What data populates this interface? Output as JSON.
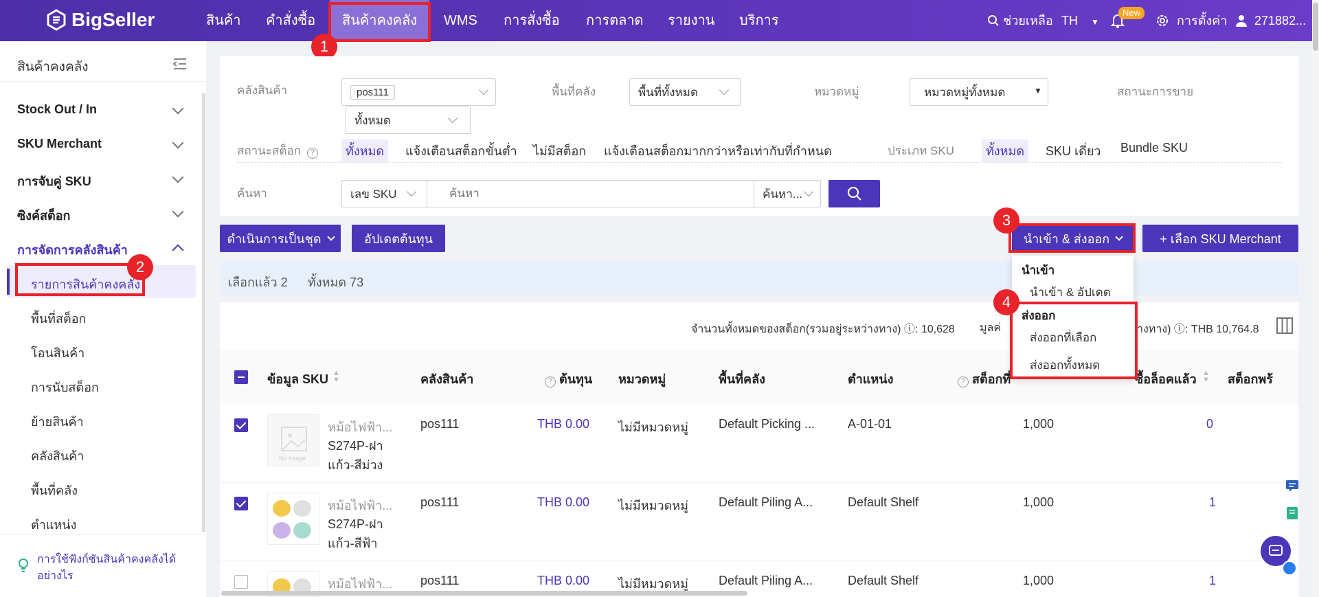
{
  "app": {
    "logo": "BigSeller"
  },
  "topnav": {
    "items": [
      "สินค้า",
      "คำสั่งซื้อ",
      "สินค้าคงคลัง",
      "WMS",
      "การสั่งซื้อ",
      "การตลาด",
      "รายงาน",
      "บริการ"
    ],
    "help": "ช่วยเหลือ",
    "lang": "TH",
    "new_badge": "New",
    "settings": "การตั้งค่า",
    "user": "271882..."
  },
  "steps": [
    "1",
    "2",
    "3",
    "4"
  ],
  "sidebar": {
    "title": "สินค้าคงคลัง",
    "groups": [
      "Stock Out / In",
      "SKU Merchant",
      "การจับคู่ SKU",
      "ซิงค์สต็อก",
      "การจัดการคลังสินค้า"
    ],
    "items": [
      "รายการสินค้าคงคลัง",
      "พื้นที่สต็อก",
      "โอนสินค้า",
      "การนับสต็อก",
      "ย้ายสินค้า",
      "คลังสินค้า",
      "พื้นที่คลัง",
      "ตำแหน่ง"
    ],
    "help_link": "การใช้ฟังก์ชันสินค้าคงคลังได้อย่างไร"
  },
  "filters": {
    "warehouse_label": "คลังสินค้า",
    "warehouse_tag": "pos111",
    "area_label": "พื้นที่คลัง",
    "area_value": "พื้นที่ทั้งหมด",
    "category_label": "หมวดหมู่",
    "category_value": "หมวดหมู่ทั้งหมด",
    "sale_status_label": "สถานะการขาย",
    "sale_status_value": "ทั้งหมด",
    "stock_status_label": "สถานะสต็อก",
    "stock_status_options": [
      "ทั้งหมด",
      "แจ้งเตือนสต็อกขั้นต่ำ",
      "ไม่มีสต็อก",
      "แจ้งเตือนสต็อกมากกว่าหรือเท่ากับที่กำหนด"
    ],
    "sku_type_label": "ประเภท SKU",
    "sku_type_options": [
      "ทั้งหมด",
      "SKU เดี่ยว",
      "Bundle SKU"
    ],
    "search_label": "ค้นหา",
    "search_field": "เลข SKU",
    "search_placeholder": "ค้นหา",
    "search_mode": "ค้นหา..."
  },
  "toolbar": {
    "batch": "ดำเนินการเป็นชุด",
    "update_cost": "อัปเดตต้นทุน",
    "import_export": "นำเข้า & ส่งออก",
    "add_sku": "+ เลือก SKU Merchant"
  },
  "selection": {
    "selected": "เลือกแล้ว 2",
    "total": "ทั้งหมด 73"
  },
  "summary": {
    "stock_total": "จำนวนทั้งหมดของสต็อก(รวมอยู่ระหว่างทาง) ⓘ: 10,628",
    "value_prefix": "มูลค่",
    "value_suffix": "างทาง) ⓘ: THB 10,764.8"
  },
  "dropdown": {
    "import_head": "นำเข้า",
    "import_item": "นำเข้า & อัปเดต",
    "export_head": "ส่งออก",
    "export_selected": "ส่งออกที่เลือก",
    "export_all": "ส่งออกทั้งหมด"
  },
  "table": {
    "headers": [
      "ข้อมูล SKU",
      "คลังสินค้า",
      "ต้นทุน",
      "หมวดหมู่",
      "พื้นที่คลัง",
      "ตำแหน่ง",
      "สต็อกที่",
      "ซื้อล็อคแล้ว",
      "สต็อกพร้"
    ],
    "rows": [
      {
        "name": "หม้อไฟฟ้า...",
        "sku1": "S274P-ฝา",
        "sku2": "แก้ว-สีม่วง",
        "warehouse": "pos111",
        "cost": "THB 0.00",
        "category": "ไม่มีหมวดหมู่",
        "area": "Default Picking ...",
        "location": "A-01-01",
        "stock": "1,000",
        "locked": "0",
        "checked": true
      },
      {
        "name": "หม้อไฟฟ้า...",
        "sku1": "S274P-ฝา",
        "sku2": "แก้ว-สีฟ้า",
        "warehouse": "pos111",
        "cost": "THB 0.00",
        "category": "ไม่มีหมวดหมู่",
        "area": "Default Piling A...",
        "location": "Default Shelf",
        "stock": "1,000",
        "locked": "1",
        "checked": true
      },
      {
        "name": "หม้อไฟฟ้า...",
        "sku1": "",
        "sku2": "",
        "warehouse": "pos111",
        "cost": "THB 0.00",
        "category": "ไม่มีหมวดหมู่",
        "area": "Default Piling A...",
        "location": "Default Shelf",
        "stock": "1,000",
        "locked": "1",
        "checked": false
      }
    ]
  },
  "no_image_label": "No Image",
  "colors": {
    "brand": "#4b35b8",
    "highlight": "#e8232a",
    "topbar": "#5a36b8"
  }
}
